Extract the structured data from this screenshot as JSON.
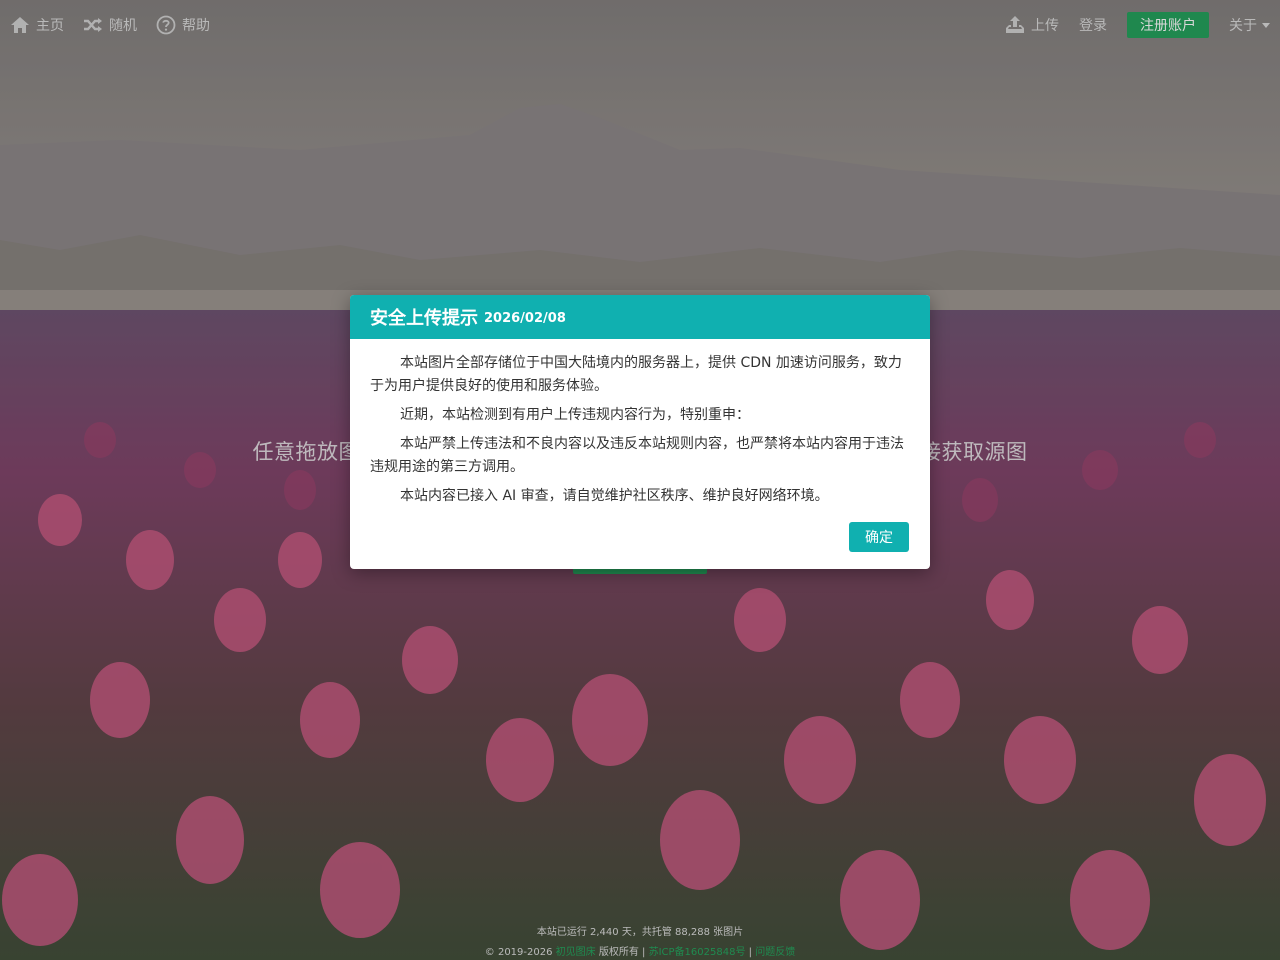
{
  "nav": {
    "home": "主页",
    "random": "随机",
    "help": "帮助",
    "upload": "上传",
    "login": "登录",
    "register": "注册账户",
    "about": "关于",
    "icons": [
      "home-icon",
      "shuffle-icon",
      "help-icon",
      "upload-icon"
    ]
  },
  "hero": {
    "text_left": "任意拖放图",
    "text_right": "接获取源图"
  },
  "modal": {
    "title": "安全上传提示",
    "date": "2026/02/08",
    "paragraphs": [
      "本站图片全部存储位于中国大陆境内的服务器上，提供 CDN 加速访问服务，致力于为用户提供良好的使用和服务体验。",
      "近期，本站检测到有用户上传违规内容行为，特别重申：",
      "本站严禁上传违法和不良内容以及违反本站规则内容，也严禁将本站内容用于违法违规用途的第三方调用。",
      "本站内容已接入 AI 审查，请自觉维护社区秩序、维护良好网络环境。"
    ],
    "confirm": "确定"
  },
  "footer": {
    "stats": "本站已运行 2,440 天，共托管 88,288 张图片",
    "copyright_prefix": "© 2019-2026",
    "site_link": "初见图床",
    "rights": "版权所有 |",
    "icp": "苏ICP备16025848号",
    "sep": "|",
    "contact": "问题反馈"
  },
  "colors": {
    "accent_teal": "#10b0b0",
    "register_green": "#1e9e57"
  }
}
